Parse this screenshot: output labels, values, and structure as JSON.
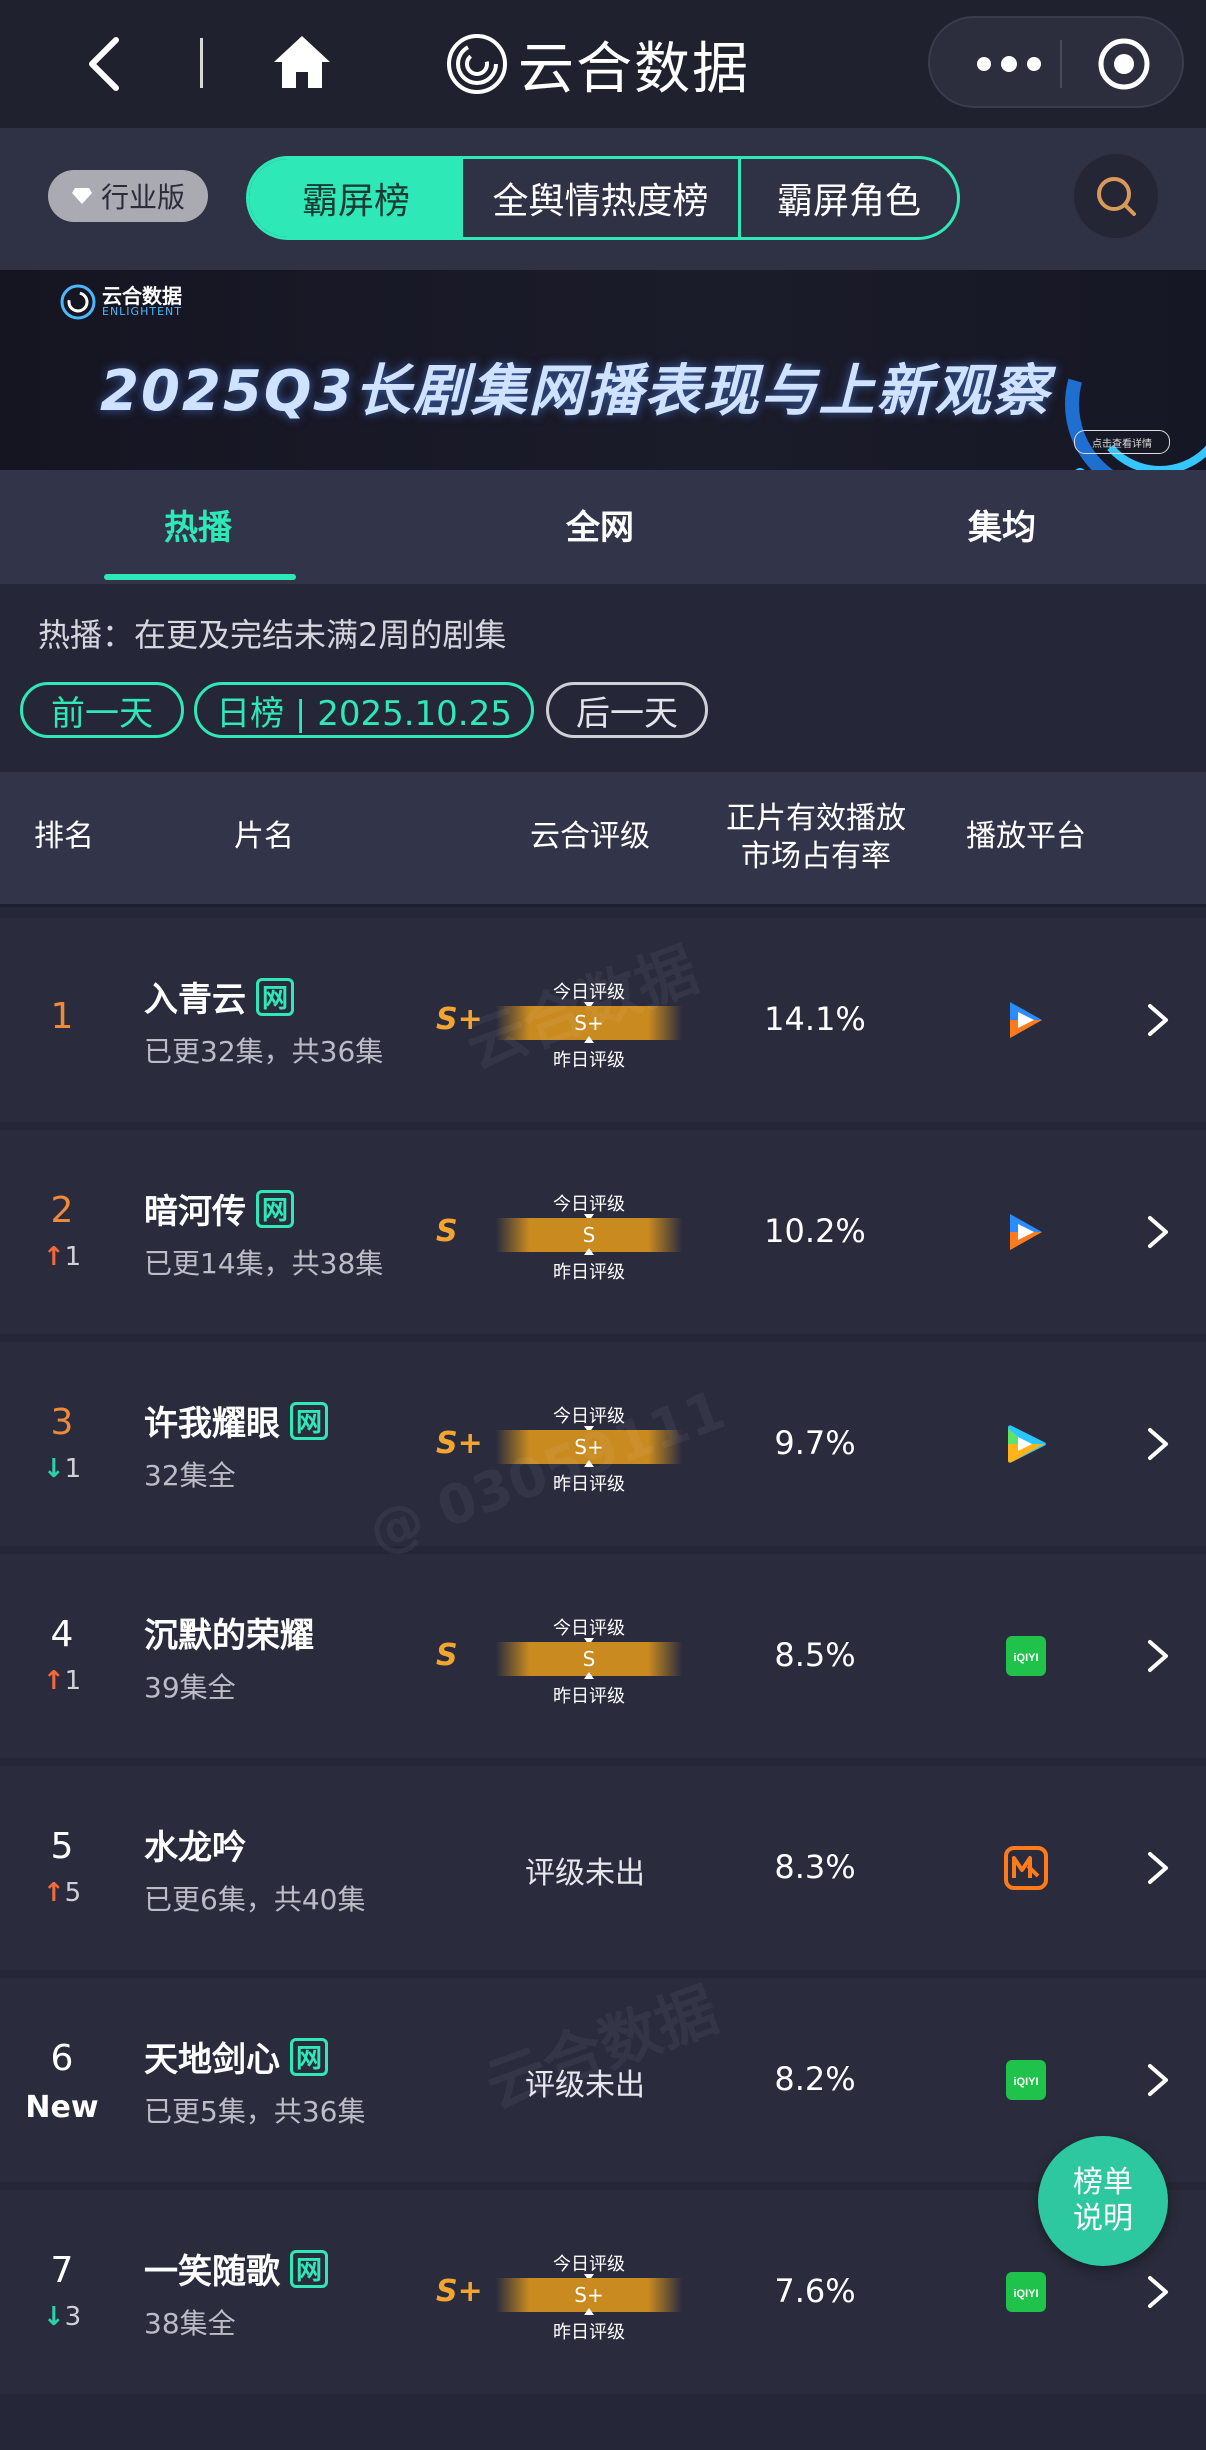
{
  "app": {
    "title": "云合数据"
  },
  "tabs": {
    "industry": "行业版",
    "segments": [
      "霸屏榜",
      "全舆情热度榜",
      "霸屏角色"
    ]
  },
  "banner": {
    "logo_cn": "云合数据",
    "logo_en": "ENLIGHTENT",
    "title": "2025Q3长剧集网播表现与上新观察",
    "button": "点击查看详情"
  },
  "subtabs": [
    "热播",
    "全网",
    "集均"
  ],
  "description": "热播：在更及完结未满2周的剧集",
  "date_nav": {
    "prev": "前一天",
    "current": "日榜 | 2025.10.25",
    "next": "后一天"
  },
  "table": {
    "headers": {
      "rank": "排名",
      "name": "片名",
      "rating": "云合评级",
      "share_line1": "正片有效播放",
      "share_line2": "市场占有率",
      "platform": "播放平台"
    },
    "gauge_top": "今日评级",
    "gauge_bottom": "昨日评级",
    "rows": [
      {
        "rank": "1",
        "change": "",
        "title": "入青云",
        "tag": "网",
        "sub": "已更32集，共36集",
        "grade": "S+",
        "today": "S+",
        "rating_text": "",
        "share": "14.1%",
        "platform": "tencent-video-icon"
      },
      {
        "rank": "2",
        "change": "1",
        "title": "暗河传",
        "tag": "网",
        "sub": "已更14集，共38集",
        "grade": "S",
        "today": "S",
        "rating_text": "",
        "share": "10.2%",
        "platform": "tencent-video-icon"
      },
      {
        "rank": "3",
        "change": "1",
        "title": "许我耀眼",
        "tag": "网",
        "sub": "32集全",
        "grade": "S+",
        "today": "S+",
        "rating_text": "",
        "share": "9.7%",
        "platform": "tencent-video-icon"
      },
      {
        "rank": "4",
        "change": "1",
        "title": "沉默的荣耀",
        "tag": "",
        "sub": "39集全",
        "grade": "S",
        "today": "S",
        "rating_text": "",
        "share": "8.5%",
        "platform": "iqiyi-icon"
      },
      {
        "rank": "5",
        "change": "5",
        "title": "水龙吟",
        "tag": "",
        "sub": "已更6集，共40集",
        "grade": "",
        "today": "",
        "rating_text": "评级未出",
        "share": "8.3%",
        "platform": "mango-tv-icon"
      },
      {
        "rank": "6",
        "change": "New",
        "title": "天地剑心",
        "tag": "网",
        "sub": "已更5集，共36集",
        "grade": "",
        "today": "",
        "rating_text": "评级未出",
        "share": "8.2%",
        "platform": "iqiyi-icon"
      },
      {
        "rank": "7",
        "change": "3",
        "title": "一笑随歌",
        "tag": "网",
        "sub": "38集全",
        "grade": "S+",
        "today": "S+",
        "rating_text": "",
        "share": "7.6%",
        "platform": "iqiyi-icon"
      }
    ]
  },
  "fab": {
    "line1": "榜单",
    "line2": "说明"
  },
  "watermark": {
    "cn": "云合数据",
    "en": "ENLIGHTENT",
    "id": "@ 03059111"
  },
  "colors": {
    "accent": "#2ee8b8",
    "grade": "#f2a630",
    "up": "#f26a3a",
    "down": "#2ed0a8"
  }
}
